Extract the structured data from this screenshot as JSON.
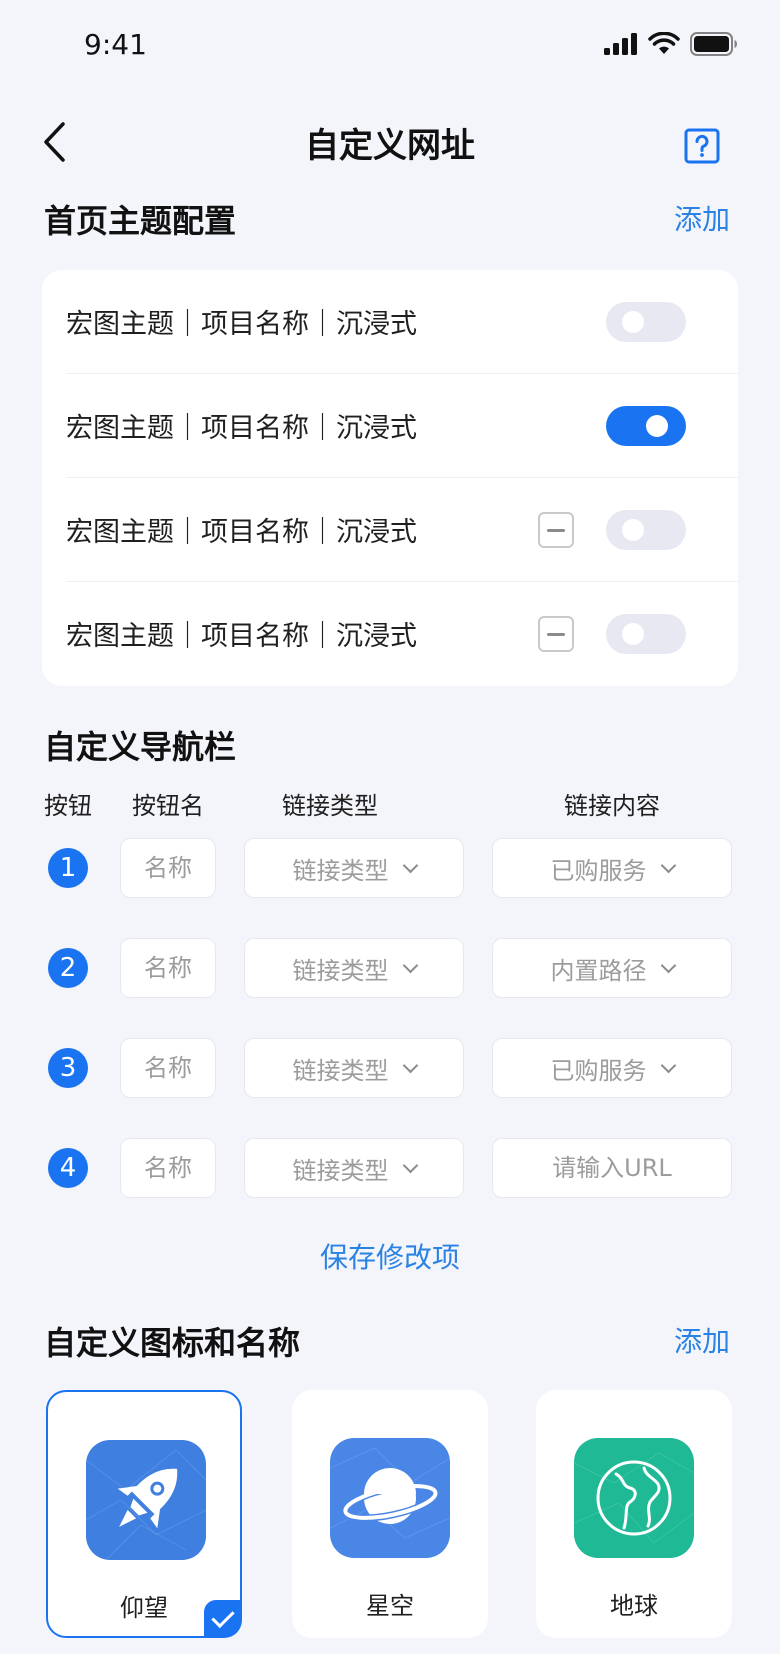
{
  "status_bar": {
    "time": "9:41"
  },
  "nav": {
    "title": "自定义网址"
  },
  "theme_section": {
    "title": "首页主题配置",
    "add_label": "添加",
    "rows": [
      {
        "label": "宏图主题｜项目名称｜沉浸式",
        "enabled": false,
        "removable": false
      },
      {
        "label": "宏图主题｜项目名称｜沉浸式",
        "enabled": true,
        "removable": false
      },
      {
        "label": "宏图主题｜项目名称｜沉浸式",
        "enabled": false,
        "removable": true
      },
      {
        "label": "宏图主题｜项目名称｜沉浸式",
        "enabled": false,
        "removable": true
      }
    ]
  },
  "navbar_section": {
    "title": "自定义导航栏",
    "columns": {
      "button": "按钮",
      "button_name": "按钮名",
      "link_type": "链接类型",
      "link_content": "链接内容"
    },
    "rows": [
      {
        "num": "1",
        "name_placeholder": "名称",
        "link_type": "链接类型",
        "link_content": "已购服务",
        "content_is_input": false
      },
      {
        "num": "2",
        "name_placeholder": "名称",
        "link_type": "链接类型",
        "link_content": "内置路径",
        "content_is_input": false
      },
      {
        "num": "3",
        "name_placeholder": "名称",
        "link_type": "链接类型",
        "link_content": "已购服务",
        "content_is_input": false
      },
      {
        "num": "4",
        "name_placeholder": "名称",
        "link_type": "链接类型",
        "link_content": "请输入URL",
        "content_is_input": true
      }
    ],
    "save_label": "保存修改项"
  },
  "icon_section": {
    "title": "自定义图标和名称",
    "add_label": "添加",
    "icons": [
      {
        "name": "仰望",
        "icon": "rocket-icon",
        "color": "#3f7fe0",
        "selected": true
      },
      {
        "name": "星空",
        "icon": "planet-icon",
        "color": "#4a86e6",
        "selected": false
      },
      {
        "name": "地球",
        "icon": "globe-icon",
        "color": "#1fb996",
        "selected": false
      }
    ]
  },
  "colors": {
    "accent": "#1a73f0",
    "link": "#2a82e4",
    "background": "#f4f5fa"
  }
}
